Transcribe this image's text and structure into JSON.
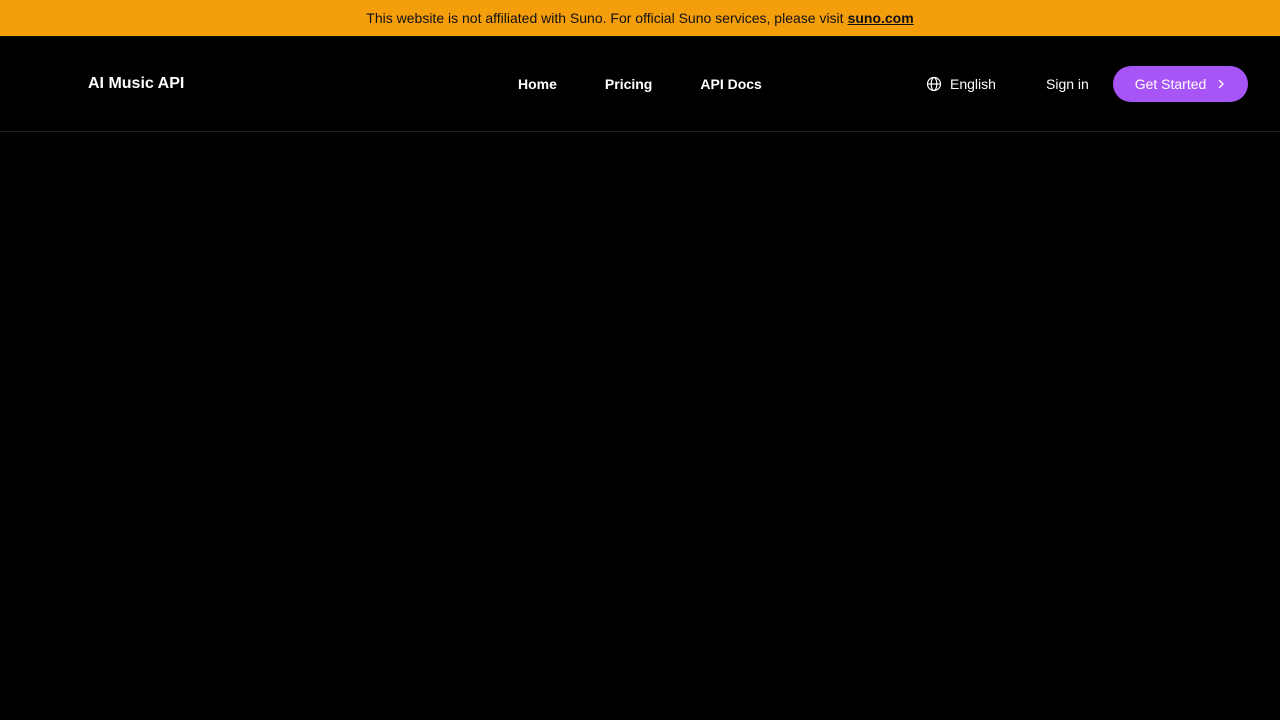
{
  "banner": {
    "text": "This website is not affiliated with Suno. For official Suno services, please visit",
    "link_text": "suno.com"
  },
  "header": {
    "brand": "AI Music API",
    "nav": [
      {
        "label": "Home"
      },
      {
        "label": "Pricing"
      },
      {
        "label": "API Docs"
      }
    ],
    "language": "English",
    "sign_in": "Sign in",
    "cta": "Get Started"
  },
  "icons": {
    "language": "globe-icon",
    "cta": "chevron-right-icon"
  },
  "colors": {
    "banner_bg": "#f59e0b",
    "page_bg": "#000000",
    "cta_bg": "#a855f7",
    "text": "#ffffff"
  }
}
